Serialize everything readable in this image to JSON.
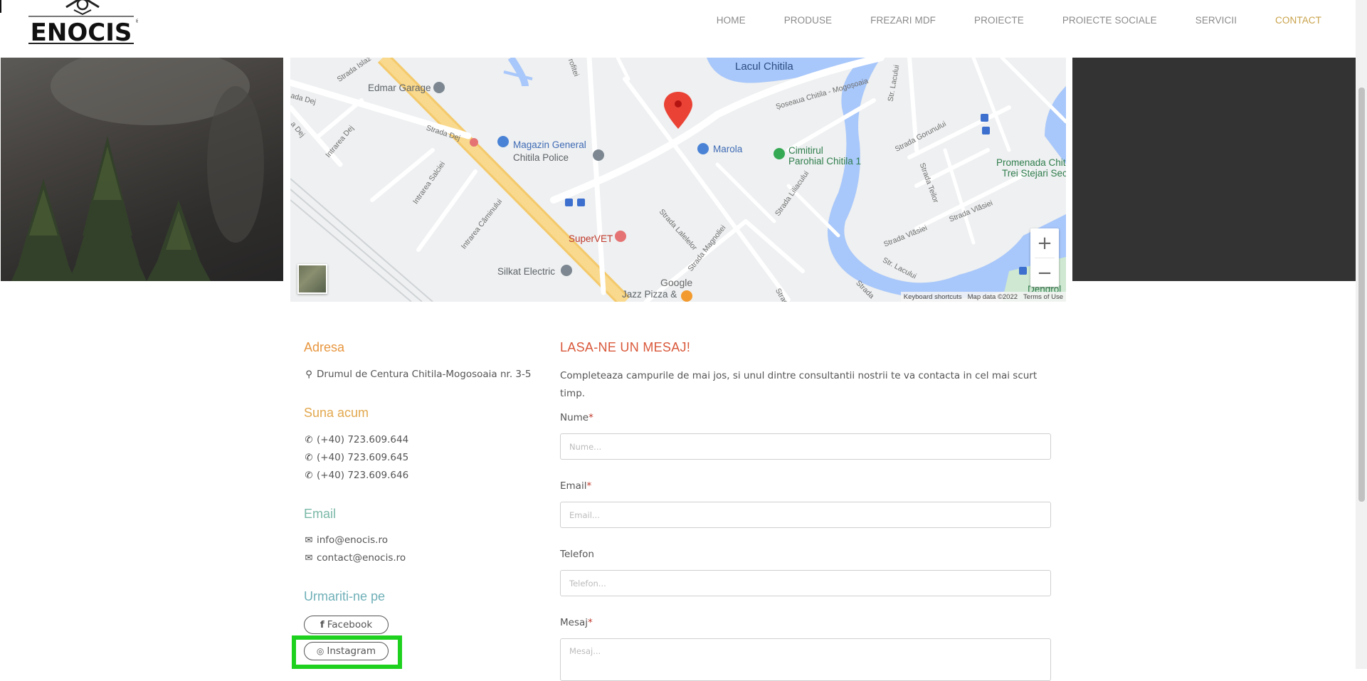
{
  "brand": {
    "logo_text": "ENOCIS"
  },
  "nav": {
    "items": [
      "HOME",
      "PRODUSE",
      "FREZARI MDF",
      "PROIECTE",
      "PROIECTE SOCIALE",
      "SERVICII",
      "CONTACT"
    ],
    "active": "CONTACT",
    "active_color": "#c9a24b"
  },
  "map": {
    "labels": {
      "edmar": "Edmar Garage",
      "magazin1": "Magazin General",
      "magazin2": "Chitila Police",
      "marola": "Marola",
      "cimitir1": "Cimitirul",
      "cimitir2": "Parohial Chitila 1",
      "promenada1": "Promenada Chit",
      "promenada2": "Trei Stejari Sec",
      "supervet": "SuperVET",
      "silkat": "Silkat Electric",
      "jazz": "Jazz Pizza &",
      "lacul": "Lacul Chitila",
      "dendrol": "Dendrol",
      "strada_dej": "Strada Dej",
      "strada_islaz": "Strada Islaz",
      "ada_dej": "ada Dej",
      "a_dej": "a Dej",
      "intrarea_dej": "Intrarea Dej",
      "intrarea_salciei": "Intrarea Salciei",
      "intrarea_caminului": "Intrarea Căminului",
      "strada_lalelelor": "Strada Lalelelor",
      "strada_magnoliei": "Strada Magnoliei",
      "soseaua": "Șoseaua Chitila - Mogoșoaia",
      "strada_liliacului": "Strada Liliacului",
      "str_lacului": "Str. Lacului",
      "str_lacului2": "Str. Lacului",
      "strada_gorunului": "Strada Gorunului",
      "strada_teilor": "Strada Teilor",
      "strada_vlasiei": "Strada Vlăsiei",
      "strada_vlasiei2": "Strada Vlăsiei",
      "strada_top": "rofitei",
      "strada_bottom": "Strad",
      "strada_bottom2": "Strada"
    },
    "google": "Google",
    "zoom_in": "+",
    "zoom_out": "−",
    "attribution": [
      "Keyboard shortcuts",
      "Map data ©2022",
      "Terms of Use"
    ]
  },
  "contact": {
    "address_title": "Adresa",
    "address": "Drumul de Centura Chitila-Mogosoaia nr. 3-5",
    "call_title": "Suna acum",
    "phones": [
      "(+40) 723.609.644",
      "(+40) 723.609.645",
      "(+40) 723.609.646"
    ],
    "email_title": "Email",
    "emails": [
      "info@enocis.ro",
      "contact@enocis.ro"
    ],
    "follow_title": "Urmariti-ne pe",
    "facebook": "Facebook",
    "instagram": "Instagram"
  },
  "form": {
    "title": "LASA-NE UN MESAJ!",
    "intro": "Completeaza campurile de mai jos, si unul dintre consultantii nostrii te va contacta in cel mai scurt timp.",
    "name_label": "Nume",
    "name_placeholder": "Nume...",
    "email_label": "Email",
    "email_placeholder": "Email...",
    "phone_label": "Telefon",
    "phone_placeholder": "Telefon...",
    "message_label": "Mesaj",
    "message_placeholder": "Mesaj...",
    "required_mark": "*"
  }
}
